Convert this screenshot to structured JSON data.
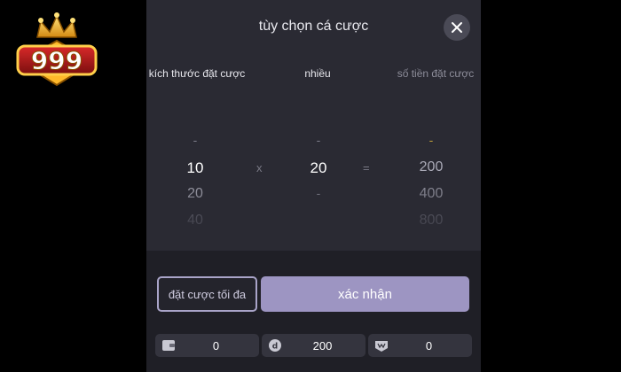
{
  "logo": {
    "text": "999"
  },
  "panel": {
    "title": "tùy chọn cá cược",
    "columns": {
      "bet_size": "kích thước đặt cược",
      "multiplier": "nhiều",
      "bet_amount": "số tiền đặt cược"
    },
    "bet_size_values": [
      "-",
      "10",
      "20",
      "40"
    ],
    "multiplier_values": [
      "-",
      "20",
      "-"
    ],
    "amount_values": [
      "-",
      "200",
      "400",
      "800"
    ],
    "times_symbol": "x",
    "equals_symbol": "="
  },
  "actions": {
    "max_bet_label": "đặt cược tối đa",
    "confirm_label": "xác nhận"
  },
  "stats": {
    "wallet": "0",
    "bet": "200",
    "win": "0"
  },
  "colors": {
    "panel_bg": "#2a2a33",
    "confirm_bg": "#9d95c2",
    "accent_gold": "#e8b93a"
  }
}
